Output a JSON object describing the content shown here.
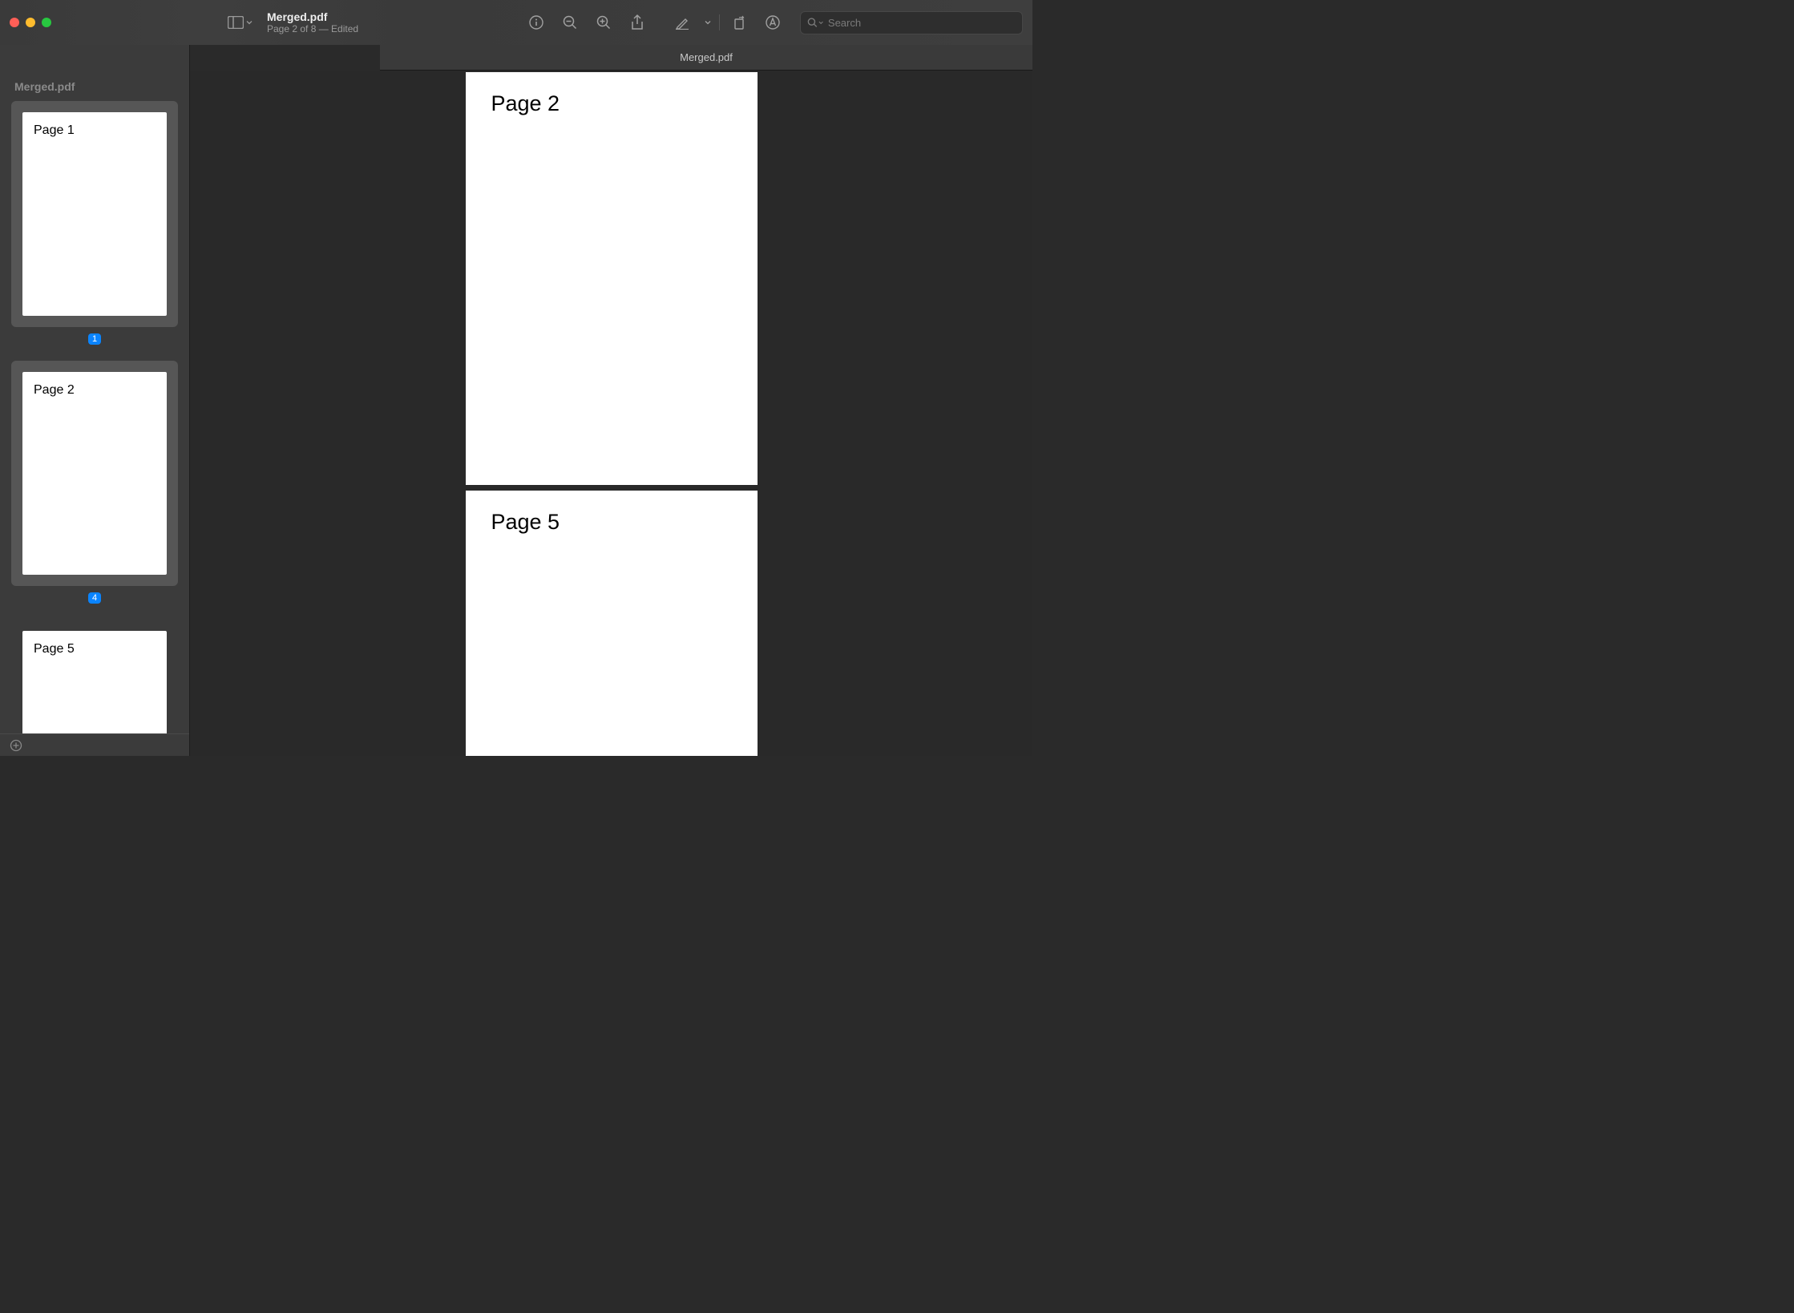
{
  "window": {
    "title": "Merged.pdf",
    "subtitle": "Page 2 of 8 — Edited",
    "tab_title": "Merged.pdf"
  },
  "sidebar": {
    "header": "Merged.pdf",
    "thumbnails": [
      {
        "label": "Page 1",
        "page_number": "1",
        "selected": true
      },
      {
        "label": "Page 2",
        "page_number": "4",
        "selected": true
      },
      {
        "label": "Page 5",
        "page_number": "",
        "selected": false
      }
    ]
  },
  "search": {
    "placeholder": "Search"
  },
  "main_pages": [
    {
      "content": "Page 2"
    },
    {
      "content": "Page 5"
    }
  ]
}
